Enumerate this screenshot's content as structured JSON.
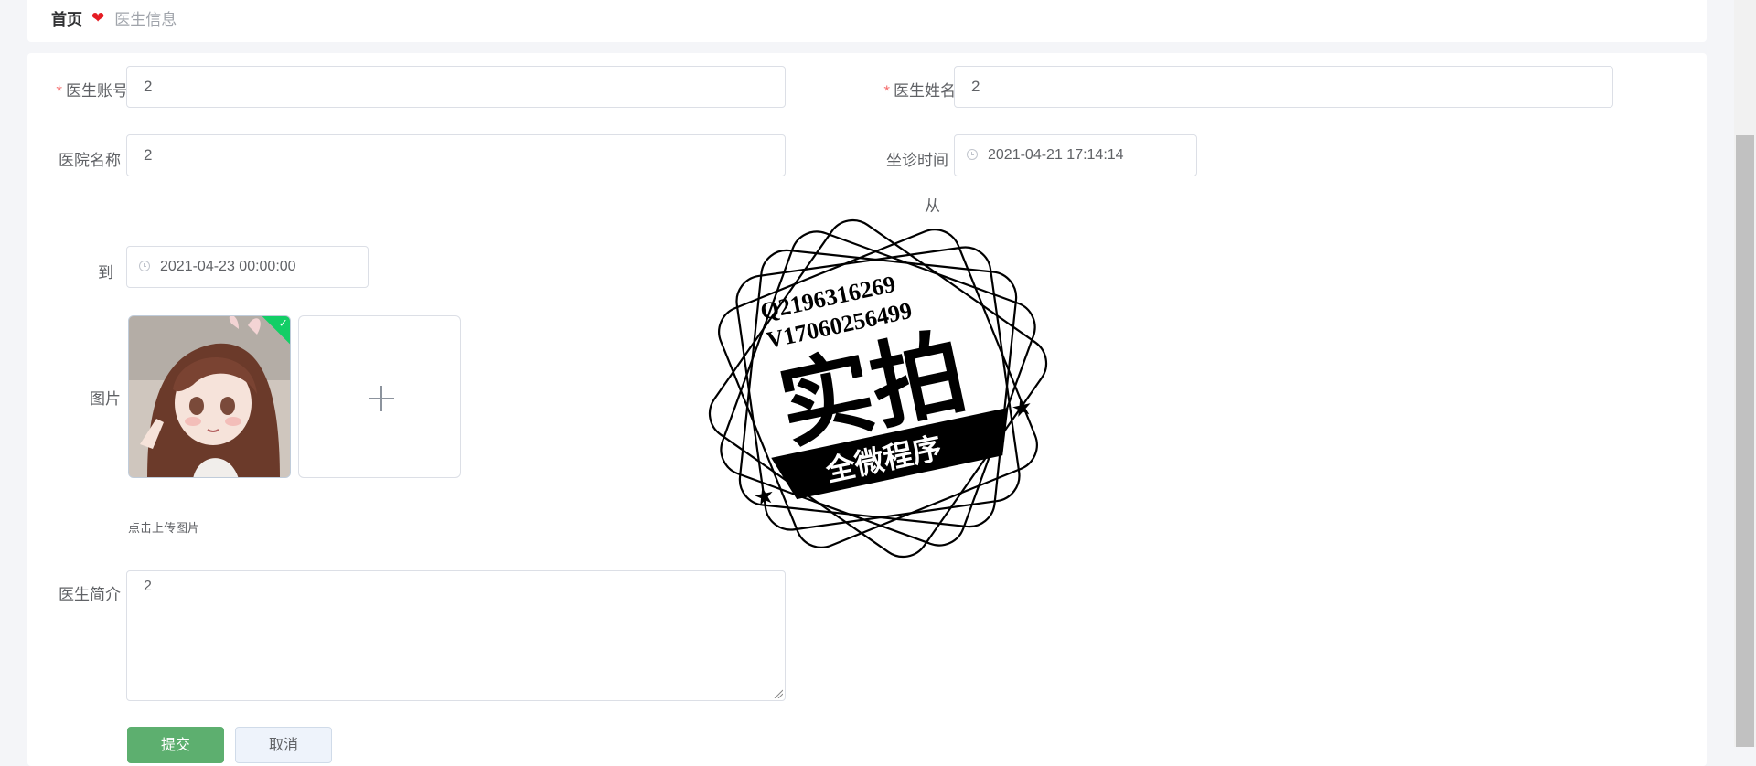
{
  "breadcrumb": {
    "home": "首页",
    "current": "医生信息"
  },
  "form": {
    "account": {
      "label": "医生账号",
      "value": "2",
      "required": true
    },
    "name": {
      "label": "医生姓名",
      "value": "2",
      "required": true
    },
    "hospital": {
      "label": "医院名称",
      "value": "2"
    },
    "clinic_time": {
      "label": "坐诊时间",
      "from_value": "2021-04-21 17:14:14",
      "from_label": "从",
      "to_label": "到",
      "to_value": "2021-04-23 00:00:00"
    },
    "image": {
      "label": "图片",
      "tip": "点击上传图片"
    },
    "intro": {
      "label": "医生简介",
      "value": "2"
    },
    "submit_label": "提交",
    "cancel_label": "取消"
  },
  "watermark": {
    "line1": "Q2196316269",
    "line2": "V17060256499",
    "main": "实拍",
    "ribbon": "全微程序"
  },
  "colors": {
    "required": "#f56c6c",
    "primary": "#5daf6f",
    "success": "#13ce66",
    "heart": "#e51c23"
  }
}
